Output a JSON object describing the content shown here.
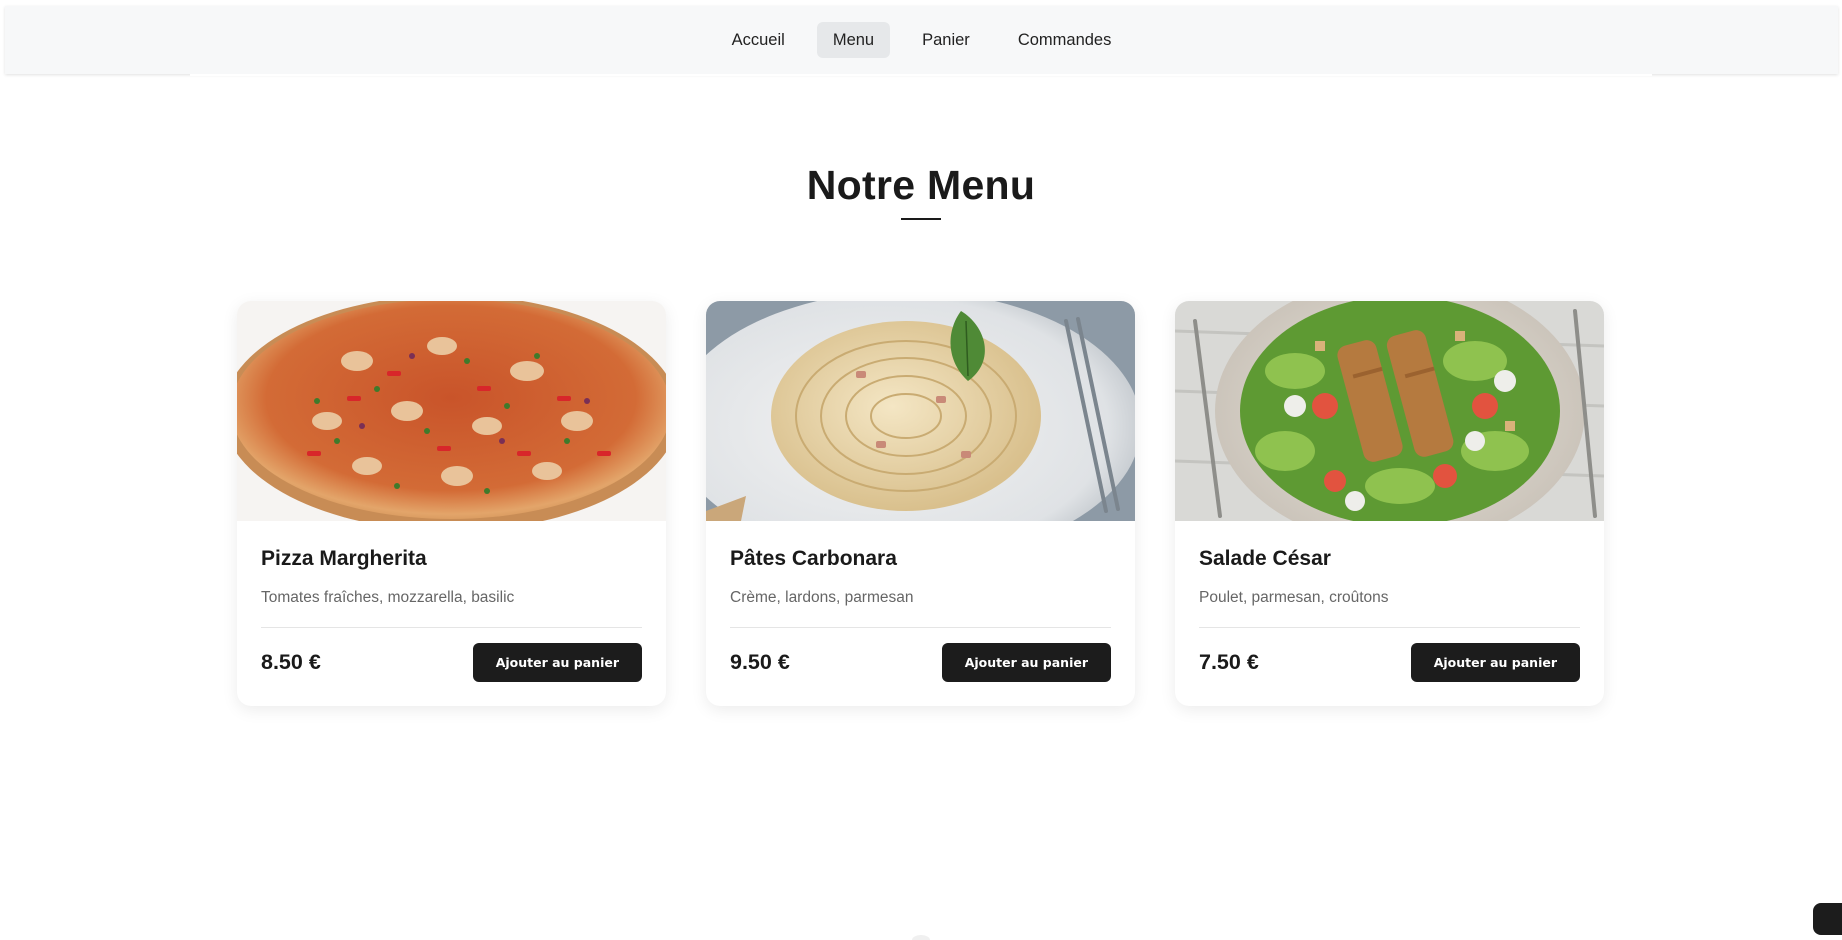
{
  "nav": {
    "items": [
      {
        "label": "Accueil",
        "active": false
      },
      {
        "label": "Menu",
        "active": true
      },
      {
        "label": "Panier",
        "active": false
      },
      {
        "label": "Commandes",
        "active": false
      }
    ]
  },
  "main": {
    "title": "Notre Menu"
  },
  "menu_items": [
    {
      "name": "Pizza Margherita",
      "description": "Tomates fraîches, mozzarella, basilic",
      "price": "8.50 €",
      "button_label": "Ajouter au panier",
      "image_icon": "pizza-image"
    },
    {
      "name": "Pâtes Carbonara",
      "description": "Crème, lardons, parmesan",
      "price": "9.50 €",
      "button_label": "Ajouter au panier",
      "image_icon": "pasta-image"
    },
    {
      "name": "Salade César",
      "description": "Poulet, parmesan, croûtons",
      "price": "7.50 €",
      "button_label": "Ajouter au panier",
      "image_icon": "salad-image"
    }
  ],
  "colors": {
    "nav_background": "#f7f8f9",
    "active_nav": "#e6e8ea",
    "button_dark": "#1c1c1c",
    "text_primary": "#1a1a1a",
    "text_secondary": "#666666"
  }
}
